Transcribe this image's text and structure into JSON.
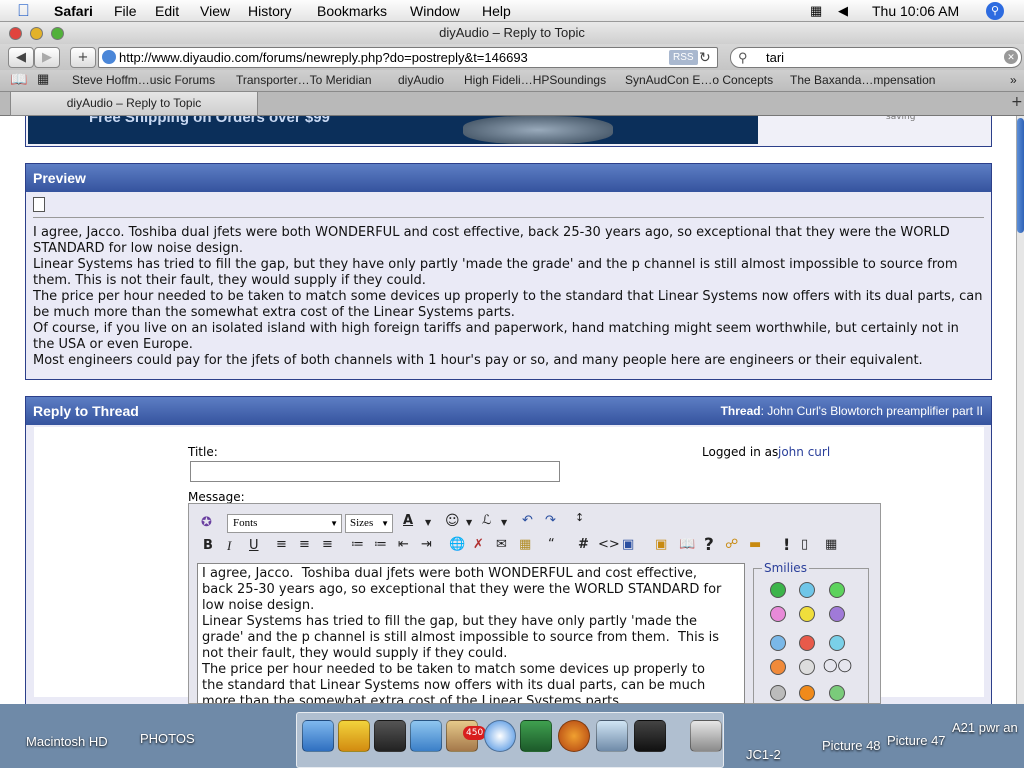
{
  "menubar": {
    "app": "Safari",
    "menus": [
      "File",
      "Edit",
      "View",
      "History",
      "Bookmarks",
      "Window",
      "Help"
    ],
    "clock": "Thu 10:06 AM"
  },
  "window": {
    "title": "diyAudio – Reply to Topic",
    "url": "http://www.diyaudio.com/forums/newreply.php?do=postreply&t=146693",
    "rss": "RSS",
    "search": "tari"
  },
  "bookmarks": [
    "Steve Hoffm…usic Forums",
    "Transporter…To Meridian",
    "diyAudio",
    "High Fideli…HPSoundings",
    "SynAudCon E…o Concepts",
    "The Baxanda…mpensation"
  ],
  "tab": {
    "label": "diyAudio – Reply to Topic"
  },
  "ad": {
    "text": "Free Shipping on Orders over $99",
    "side": "saving"
  },
  "preview": {
    "heading": "Preview",
    "paragraphs": [
      "I agree, Jacco. Toshiba dual jfets were both WONDERFUL and cost effective, back 25-30 years ago, so exceptional that they were the WORLD STANDARD for low noise design.",
      "Linear Systems has tried to fill the gap, but they have only partly 'made the grade' and the p channel is still almost impossible to source from them. This is not their fault, they would supply if they could.",
      "The price per hour needed to be taken to match some devices up properly to the standard that Linear Systems now offers with its dual parts, can be much more than the somewhat extra cost of the Linear Systems parts.",
      "Of course, if you live on an isolated island with high foreign tariffs and paperwork, hand matching might seem worthwhile, but certainly not in the USA or even Europe.",
      "Most engineers could pay for the jfets of both channels with 1 hour's pay or so, and many people here are engineers or their equivalent."
    ]
  },
  "reply": {
    "heading": "Reply to Thread",
    "thread_label": "Thread",
    "thread_title": "John Curl's Blowtorch preamplifier part II",
    "title_label": "Title:",
    "logged_in_label": "Logged in as",
    "user": "john curl",
    "message_label": "Message:",
    "fonts": "Fonts",
    "sizes": "Sizes",
    "smilies_label": "Smilies",
    "message_lines": [
      "I agree, Jacco.  Toshiba dual jfets were both WONDERFUL and cost effective,",
      "back 25-30 years ago, so exceptional that they were the WORLD STANDARD for",
      "low noise design.",
      "Linear Systems has tried to fill the gap, but they have only partly 'made the",
      "grade' and the p channel is still almost impossible to source from them.  This is",
      "not their fault, they would supply if they could.",
      "The price per hour needed to be taken to match some devices up properly to",
      "the standard that Linear Systems now offers with its dual parts, can be much",
      "more than the somewhat extra cost of the Linear Systems parts."
    ]
  },
  "dock": {
    "desktop_items": [
      "Macintosh HD",
      "PHOTOS",
      "JC1-2",
      "Picture 48",
      "Picture 47",
      "A21 pwr an"
    ],
    "badge": "450"
  },
  "colors": {
    "panel_header": "#35539e",
    "link": "#2a3f9a",
    "border": "#2c3f8a"
  }
}
